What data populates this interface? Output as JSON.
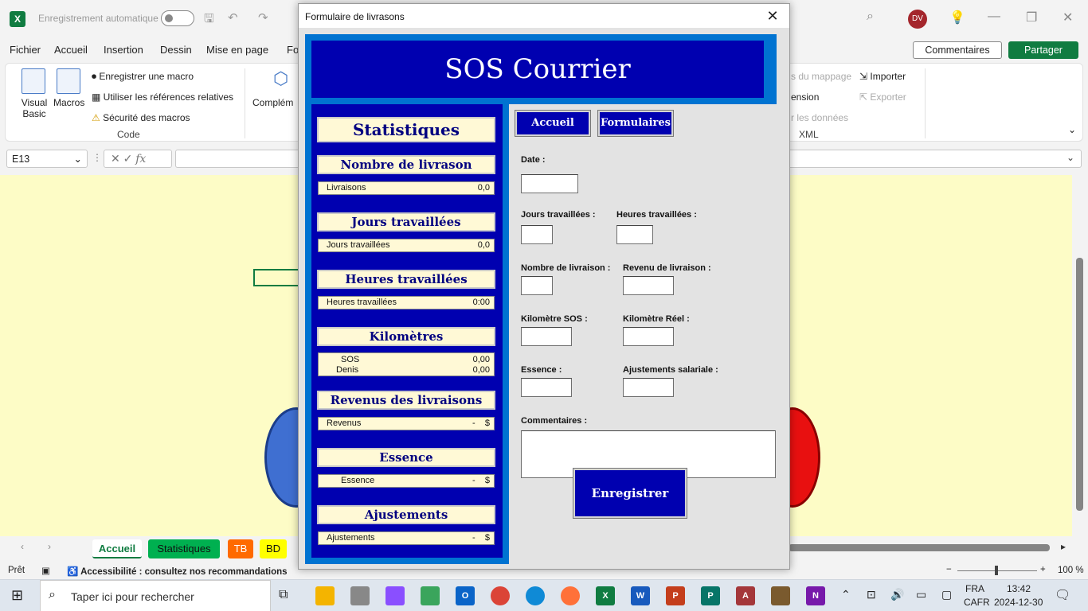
{
  "excel": {
    "autosave_label": "Enregistrement automatique",
    "avatar_initials": "DV",
    "tabs": [
      "Fichier",
      "Accueil",
      "Insertion",
      "Dessin",
      "Mise en page",
      "Fo"
    ],
    "comments_label": "Commentaires",
    "share_label": "Partager",
    "ribbon": {
      "visual_basic": "Visual Basic",
      "macros": "Macros",
      "record_macro": "Enregistrer une macro",
      "relative_refs": "Utiliser les références relatives",
      "macro_security": "Sécurité des macros",
      "code_group": "Code",
      "addins": "Complém",
      "mapping": "s du mappage",
      "extension": "ension",
      "data": "r les données",
      "import": "Importer",
      "export": "Exporter",
      "xml_group": "XML"
    },
    "name_box": "E13",
    "sheet_tabs": [
      {
        "label": "Accueil"
      },
      {
        "label": "Statistiques"
      },
      {
        "label": "TB"
      },
      {
        "label": "BD"
      }
    ],
    "status": {
      "ready": "Prêt",
      "accessibility": "Accessibilité : consultez nos recommandations",
      "zoom": "100 %"
    }
  },
  "taskbar": {
    "search_placeholder": "Taper ici pour rechercher",
    "lang1": "FRA",
    "lang2": "CAFR",
    "time": "13:42",
    "date": "2024-12-30"
  },
  "form": {
    "window_title": "Formulaire de livrasons",
    "banner": "SOS Courrier",
    "stats_title": "Statistiques",
    "sections": [
      {
        "heading": "Nombre de livrason",
        "rows": [
          {
            "label": "Livraisons",
            "value": "0,0"
          }
        ]
      },
      {
        "heading": "Jours travaillées",
        "rows": [
          {
            "label": "Jours travaillées",
            "value": "0,0"
          }
        ]
      },
      {
        "heading": "Heures travaillées",
        "rows": [
          {
            "label": "Heures travaillées",
            "value": "0:00"
          }
        ]
      },
      {
        "heading": "Kilomètres",
        "rows": [
          {
            "label": "SOS",
            "value": "0,00"
          },
          {
            "label": "Denis",
            "value": "0,00"
          }
        ]
      },
      {
        "heading": "Revenus des livraisons",
        "rows": [
          {
            "label": "Revenus",
            "value": "-    $"
          }
        ]
      },
      {
        "heading": "Essence",
        "rows": [
          {
            "label": "Essence",
            "value": "-    $"
          }
        ]
      },
      {
        "heading": "Ajustements",
        "rows": [
          {
            "label": "Ajustements",
            "value": "-    $"
          }
        ]
      }
    ],
    "nav": {
      "home": "Accueil",
      "forms": "Formulaires"
    },
    "fields": {
      "date": "Date :",
      "days": "Jours travaillées :",
      "hours": "Heures travaillées :",
      "deliveries": "Nombre de livraison :",
      "revenue": "Revenu de livraison :",
      "km_sos": "Kilomètre SOS :",
      "km_real": "Kilomètre Réel :",
      "fuel": "Essence :",
      "adjust": "Ajustements salariale :",
      "comments": "Commentaires :"
    },
    "values": {
      "date": "",
      "days": "",
      "hours": "",
      "deliveries": "",
      "revenue": "",
      "km_sos": "",
      "km_real": "",
      "fuel": "",
      "adjust": "",
      "comments": ""
    },
    "submit": "Enregistrer"
  }
}
